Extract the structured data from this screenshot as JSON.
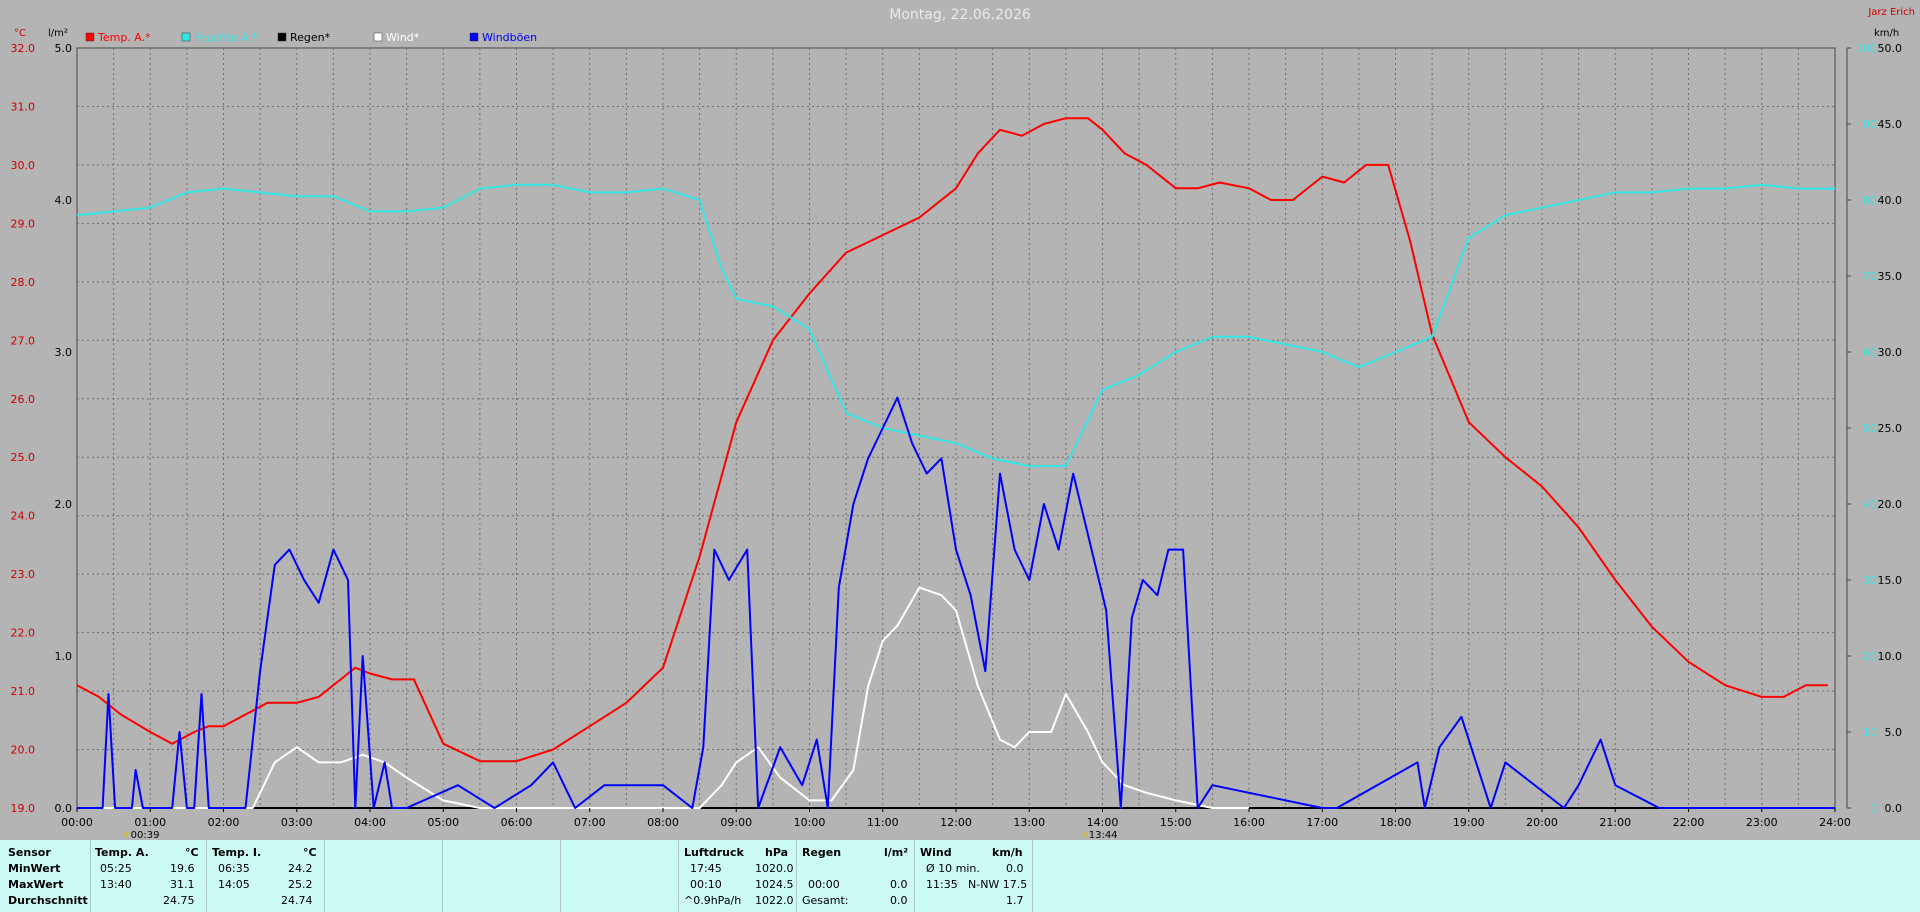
{
  "title": "Montag, 22.06.2026",
  "author": "Jarz Erich",
  "axes": {
    "temp_unit": "°C",
    "rain_unit": "l/m²",
    "wind_unit": "km/h",
    "temp_ticks": [
      "19.0",
      "20.0",
      "21.0",
      "22.0",
      "23.0",
      "24.0",
      "25.0",
      "26.0",
      "27.0",
      "28.0",
      "29.0",
      "30.0",
      "31.0",
      "32.0"
    ],
    "rain_ticks": [
      "0.0",
      "1.0",
      "2.0",
      "3.0",
      "4.0",
      "5.0"
    ],
    "hum_ticks": [
      "0",
      "10",
      "20",
      "30",
      "40",
      "50",
      "60",
      "70",
      "80",
      "90",
      "100"
    ],
    "wind_ticks": [
      "0.0",
      "5.0",
      "10.0",
      "15.0",
      "20.0",
      "25.0",
      "30.0",
      "35.0",
      "40.0",
      "45.0",
      "50.0"
    ],
    "time_ticks": [
      "00:00",
      "01:00",
      "02:00",
      "03:00",
      "04:00",
      "05:00",
      "06:00",
      "07:00",
      "08:00",
      "09:00",
      "10:00",
      "11:00",
      "12:00",
      "13:00",
      "14:00",
      "15:00",
      "16:00",
      "17:00",
      "18:00",
      "19:00",
      "20:00",
      "21:00",
      "22:00",
      "23:00",
      "24:00"
    ],
    "markers": [
      {
        "label": "00:39",
        "hour": 0.65
      },
      {
        "label": "13:44",
        "hour": 13.73
      }
    ]
  },
  "legend": [
    {
      "label": "Temp. A.*",
      "color": "#ff0000"
    },
    {
      "label": "Feuchte A.*",
      "color": "#33e6e6"
    },
    {
      "label": "Regen*",
      "color": "#000000"
    },
    {
      "label": "Wind*",
      "color": "#ffffff"
    },
    {
      "label": "Windböen",
      "color": "#0000ff"
    }
  ],
  "chart_data": {
    "type": "line",
    "title": "Montag, 22.06.2026",
    "xlim": [
      0,
      24
    ],
    "series": [
      {
        "name": "Temp. A.*",
        "axis": "temp",
        "ylim": [
          19,
          32
        ],
        "color": "#ff0000",
        "x": [
          0,
          0.3,
          0.6,
          1,
          1.3,
          1.6,
          1.8,
          2,
          2.3,
          2.6,
          3,
          3.3,
          3.6,
          3.8,
          4,
          4.3,
          4.6,
          5,
          5.5,
          6,
          6.5,
          7,
          7.5,
          8,
          8.5,
          9,
          9.5,
          10,
          10.5,
          11,
          11.5,
          12,
          12.3,
          12.6,
          12.9,
          13.2,
          13.5,
          13.8,
          14,
          14.3,
          14.6,
          15,
          15.3,
          15.6,
          16,
          16.3,
          16.6,
          17,
          17.3,
          17.6,
          17.9,
          18.2,
          18.5,
          19,
          19.5,
          20,
          20.5,
          21,
          21.5,
          22,
          22.5,
          23,
          23.3,
          23.6,
          23.9
        ],
        "y": [
          21.1,
          20.9,
          20.6,
          20.3,
          20.1,
          20.3,
          20.4,
          20.4,
          20.6,
          20.8,
          20.8,
          20.9,
          21.2,
          21.4,
          21.3,
          21.2,
          21.2,
          20.1,
          19.8,
          19.8,
          20.0,
          20.4,
          20.8,
          21.4,
          23.3,
          25.6,
          27.0,
          27.8,
          28.5,
          28.8,
          29.1,
          29.6,
          30.2,
          30.6,
          30.5,
          30.7,
          30.8,
          30.8,
          30.6,
          30.2,
          30.0,
          29.6,
          29.6,
          29.7,
          29.6,
          29.4,
          29.4,
          29.8,
          29.7,
          30.0,
          30.0,
          28.7,
          27.1,
          25.6,
          25.0,
          24.5,
          23.8,
          22.9,
          22.1,
          21.5,
          21.1,
          20.9,
          20.9,
          21.1,
          21.1
        ]
      },
      {
        "name": "Feuchte A.*",
        "axis": "hum",
        "ylim": [
          0,
          100
        ],
        "color": "#33e6e6",
        "x": [
          0,
          0.5,
          1,
          1.5,
          2,
          2.5,
          3,
          3.5,
          4,
          4.5,
          5,
          5.5,
          6,
          6.5,
          7,
          7.5,
          8,
          8.5,
          8.8,
          9,
          9.5,
          10,
          10.5,
          11,
          11.5,
          12,
          12.5,
          13,
          13.5,
          14,
          14.5,
          15,
          15.5,
          16,
          16.5,
          17,
          17.5,
          18,
          18.5,
          19,
          19.5,
          20,
          20.5,
          21,
          21.5,
          22,
          22.5,
          23,
          23.5,
          24
        ],
        "y": [
          78,
          78.5,
          79,
          81,
          81.5,
          81,
          80.5,
          80.5,
          78.5,
          78.5,
          79,
          81.5,
          82,
          82,
          81,
          81,
          81.5,
          80,
          71,
          67,
          66,
          63,
          52,
          50,
          49,
          48,
          46,
          45,
          45,
          55,
          57,
          60,
          62,
          62,
          61,
          60,
          58,
          60,
          62,
          75,
          78,
          79,
          80,
          81,
          81,
          81.5,
          81.5,
          82,
          81.5,
          81.5
        ]
      },
      {
        "name": "Regen*",
        "axis": "rain",
        "ylim": [
          0,
          5
        ],
        "color": "#000000",
        "x": [
          0,
          24
        ],
        "y": [
          0,
          0
        ]
      },
      {
        "name": "Wind*",
        "axis": "wind",
        "ylim": [
          0,
          50
        ],
        "color": "#ffffff",
        "x": [
          0,
          2.4,
          2.7,
          3,
          3.3,
          3.6,
          3.9,
          4.2,
          4.5,
          5,
          5.5,
          6,
          6.5,
          7,
          7.5,
          8,
          8.5,
          8.8,
          9,
          9.3,
          9.6,
          10,
          10.3,
          10.6,
          10.8,
          11,
          11.2,
          11.5,
          11.8,
          12,
          12.3,
          12.6,
          12.8,
          13,
          13.3,
          13.5,
          13.8,
          14,
          14.3,
          14.6,
          15,
          15.5,
          16
        ],
        "y": [
          0,
          0,
          3,
          4,
          3,
          3,
          3.5,
          3,
          2,
          0.5,
          0,
          0,
          0,
          0,
          0,
          0,
          0,
          1.5,
          3,
          4,
          2,
          0.5,
          0.5,
          2.5,
          8,
          11,
          12,
          14.5,
          14,
          13,
          8,
          4.5,
          4,
          5,
          5,
          7.5,
          5,
          3,
          1.5,
          1,
          0.5,
          0,
          0
        ]
      },
      {
        "name": "Windböen",
        "axis": "wind",
        "ylim": [
          0,
          50
        ],
        "color": "#0000ff",
        "x": [
          0,
          0.35,
          0.43,
          0.52,
          0.6,
          0.75,
          0.8,
          0.9,
          1.3,
          1.4,
          1.5,
          1.6,
          1.7,
          1.8,
          2.3,
          2.5,
          2.7,
          2.9,
          3.1,
          3.3,
          3.5,
          3.7,
          3.8,
          3.9,
          4.05,
          4.2,
          4.3,
          4.5,
          5.2,
          5.7,
          6.2,
          6.5,
          6.8,
          7.2,
          7.6,
          8,
          8.4,
          8.55,
          8.7,
          8.9,
          9.15,
          9.3,
          9.6,
          9.9,
          10.1,
          10.25,
          10.4,
          10.6,
          10.8,
          11,
          11.2,
          11.4,
          11.6,
          11.8,
          12,
          12.2,
          12.4,
          12.6,
          12.8,
          13,
          13.2,
          13.4,
          13.6,
          13.8,
          14.05,
          14.25,
          14.4,
          14.55,
          14.75,
          14.9,
          15.1,
          15.3,
          15.5,
          17,
          17.2,
          18.3,
          18.4,
          18.6,
          18.9,
          19.3,
          19.5,
          20.3,
          20.5,
          20.8,
          21.0,
          21.6,
          22.5,
          24
        ],
        "y": [
          0,
          0,
          7.5,
          0,
          0,
          0,
          2.5,
          0,
          0,
          5,
          0,
          0,
          7.5,
          0,
          0,
          9,
          16,
          17,
          15,
          13.5,
          17,
          15,
          0,
          10,
          0,
          3,
          0,
          0,
          1.5,
          0,
          1.5,
          3,
          0,
          1.5,
          1.5,
          1.5,
          0,
          4,
          17,
          15,
          17,
          0,
          4,
          1.5,
          4.5,
          0,
          14.5,
          20,
          23,
          25,
          27,
          24,
          22,
          23,
          17,
          14,
          9,
          22,
          17,
          15,
          20,
          17,
          22,
          18,
          13,
          0,
          12.5,
          15,
          14,
          17,
          17,
          0,
          1.5,
          0,
          0,
          3,
          0,
          4,
          6,
          0,
          3,
          0,
          1.5,
          4.5,
          1.5,
          0,
          0,
          0
        ]
      }
    ]
  },
  "stats": {
    "h_sensor": "Sensor",
    "h_ta": "Temp. A.",
    "h_ta_u": "°C",
    "h_ti": "Temp. I.",
    "h_ti_u": "°C",
    "r_min": "MinWert",
    "r_max": "MaxWert",
    "r_avg": "Durchschnitt",
    "ta_min_t": "05:25",
    "ta_min": "19.6",
    "ta_max_t": "13:40",
    "ta_max": "31.1",
    "ta_avg": "24.75",
    "ti_min_t": "06:35",
    "ti_min": "24.2",
    "ti_max_t": "14:05",
    "ti_max": "25.2",
    "ti_avg": "24.74",
    "h_lp": "Luftdruck",
    "h_lp_u": "hPa",
    "lp_min_t": "17:45",
    "lp_min": "1020.0",
    "lp_max_t": "00:10",
    "lp_max": "1024.5",
    "lp_avg_t": "^0.9hPa/h",
    "lp_avg": "1022.0",
    "h_rain": "Regen",
    "h_rain_u": "l/m²",
    "rain_max_t": "00:00",
    "rain_max": "0.0",
    "rain_tot_l": "Gesamt:",
    "rain_tot": "0.0",
    "h_wind": "Wind",
    "h_wind_u": "km/h",
    "w_min_t": "Ø 10 min.",
    "w_min": "0.0",
    "w_max_t": "11:35",
    "w_max": "N-NW 17.5",
    "w_avg": "1.7"
  }
}
